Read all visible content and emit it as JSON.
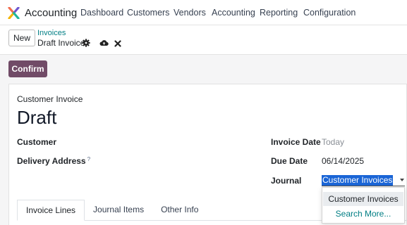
{
  "app": {
    "name": "Accounting"
  },
  "nav": [
    "Dashboard",
    "Customers",
    "Vendors",
    "Accounting",
    "Reporting",
    "Configuration"
  ],
  "control": {
    "new_label": "New",
    "breadcrumb_parent": "Invoices",
    "breadcrumb_current": "Draft Invoice"
  },
  "actions": {
    "confirm_label": "Confirm"
  },
  "form": {
    "document_type": "Customer Invoice",
    "status_title": "Draft",
    "customer_label": "Customer",
    "delivery_label": "Delivery Address",
    "delivery_help": "?",
    "invoice_date_label": "Invoice Date",
    "invoice_date_placeholder": "Today",
    "due_date_label": "Due Date",
    "due_date_value": "06/14/2025",
    "journal_label": "Journal",
    "journal_value": "Customer Invoices"
  },
  "tabs": [
    "Invoice Lines",
    "Journal Items",
    "Other Info"
  ],
  "dropdown": {
    "options": [
      "Customer Invoices"
    ],
    "search_more": "Search More..."
  },
  "colors": {
    "brand": "#714b67",
    "link": "#017e84",
    "selection": "#1a65d6"
  }
}
